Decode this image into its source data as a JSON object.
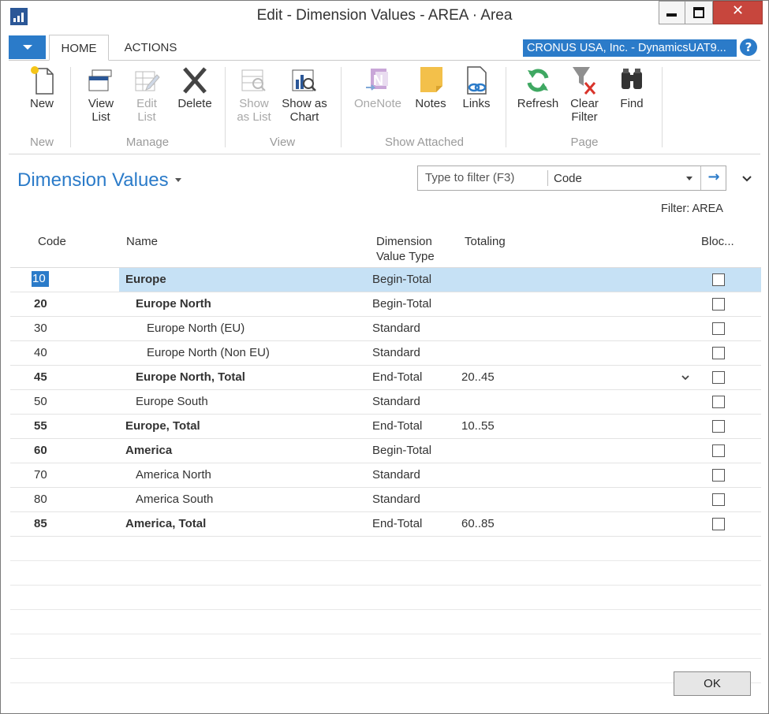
{
  "window": {
    "title": "Edit - Dimension Values - AREA · Area",
    "close_glyph": "✕"
  },
  "ribbon_tabs": [
    {
      "label": "HOME",
      "active": true
    },
    {
      "label": "ACTIONS",
      "active": false
    }
  ],
  "company": "CRONUS USA, Inc. - DynamicsUAT9...",
  "help_glyph": "?",
  "ribbon": {
    "new": "New",
    "view_list": [
      "View",
      "List"
    ],
    "edit_list": [
      "Edit",
      "List"
    ],
    "delete": "Delete",
    "show_as_list": [
      "Show",
      "as List"
    ],
    "show_as_chart": [
      "Show as",
      "Chart"
    ],
    "onenote": "OneNote",
    "notes": "Notes",
    "links": "Links",
    "refresh": "Refresh",
    "clear_filter": [
      "Clear",
      "Filter"
    ],
    "find": "Find",
    "groups": {
      "new": "New",
      "manage": "Manage",
      "view": "View",
      "show_attached": "Show Attached",
      "page": "Page"
    }
  },
  "page": {
    "title": "Dimension Values",
    "filter_placeholder": "Type to filter (F3)",
    "filter_field": "Code",
    "filter_go_glyph": "→",
    "filter_label": "Filter: AREA"
  },
  "grid": {
    "headers": {
      "code": "Code",
      "name": "Name",
      "dvt_line1": "Dimension",
      "dvt_line2": "Value Type",
      "totaling": "Totaling",
      "blocked": "Bloc..."
    },
    "rows": [
      {
        "code": "10",
        "name": "Europe",
        "type": "Begin-Total",
        "totaling": "",
        "bold": true,
        "indent": 0,
        "selected": true
      },
      {
        "code": "20",
        "name": "Europe North",
        "type": "Begin-Total",
        "totaling": "",
        "bold": true,
        "indent": 1
      },
      {
        "code": "30",
        "name": "Europe North (EU)",
        "type": "Standard",
        "totaling": "",
        "bold": false,
        "indent": 2
      },
      {
        "code": "40",
        "name": "Europe North (Non EU)",
        "type": "Standard",
        "totaling": "",
        "bold": false,
        "indent": 2
      },
      {
        "code": "45",
        "name": "Europe North, Total",
        "type": "End-Total",
        "totaling": "20..45",
        "bold": true,
        "indent": 1,
        "chevron": true
      },
      {
        "code": "50",
        "name": "Europe South",
        "type": "Standard",
        "totaling": "",
        "bold": false,
        "indent": 1
      },
      {
        "code": "55",
        "name": "Europe, Total",
        "type": "End-Total",
        "totaling": "10..55",
        "bold": true,
        "indent": 0
      },
      {
        "code": "60",
        "name": "America",
        "type": "Begin-Total",
        "totaling": "",
        "bold": true,
        "indent": 0
      },
      {
        "code": "70",
        "name": "America North",
        "type": "Standard",
        "totaling": "",
        "bold": false,
        "indent": 1
      },
      {
        "code": "80",
        "name": "America South",
        "type": "Standard",
        "totaling": "",
        "bold": false,
        "indent": 1
      },
      {
        "code": "85",
        "name": "America, Total",
        "type": "End-Total",
        "totaling": "60..85",
        "bold": true,
        "indent": 0
      }
    ]
  },
  "ok_label": "OK",
  "colors": {
    "accent": "#2b7bc9",
    "selection": "#c6e1f5",
    "close": "#c7463d"
  }
}
